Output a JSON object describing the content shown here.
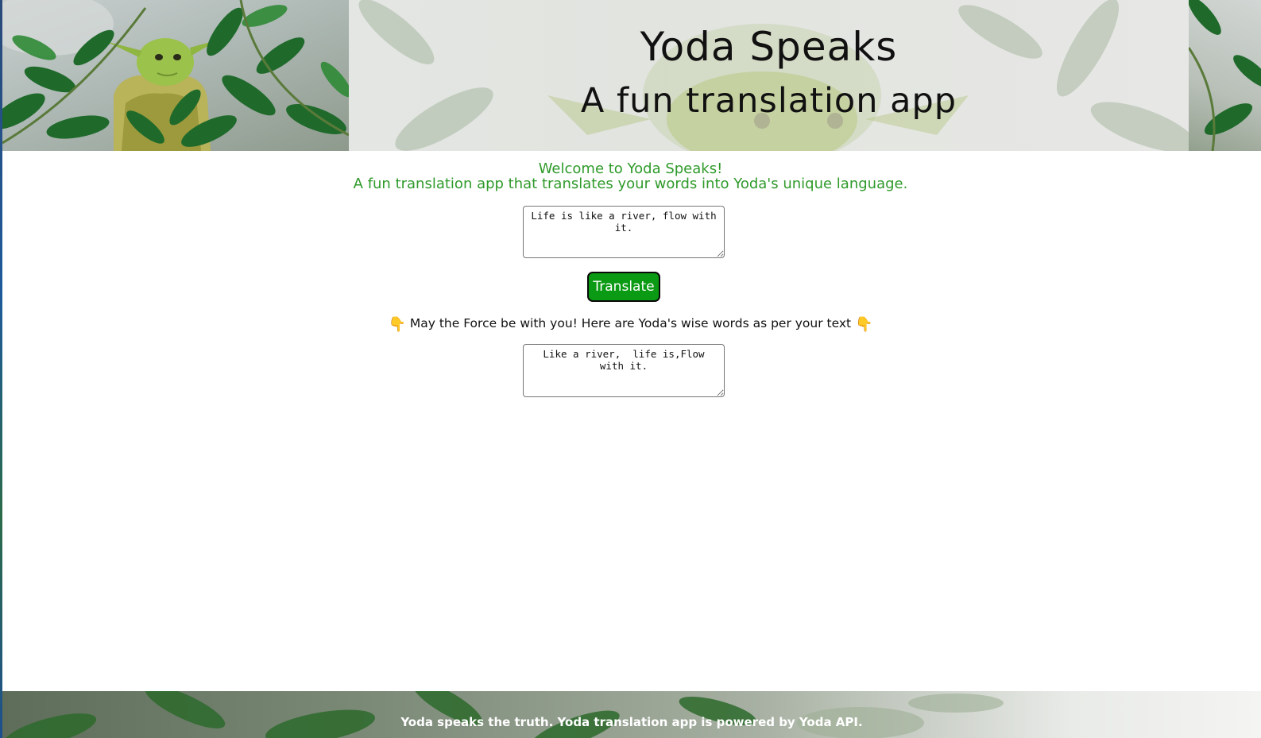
{
  "header": {
    "title": "Yoda Speaks",
    "subtitle": "A fun translation app"
  },
  "intro": {
    "line1": "Welcome to Yoda Speaks!",
    "line2": "A fun translation app that translates your words into Yoda's unique language."
  },
  "input": {
    "value": "Life is like a river, flow with it."
  },
  "translate_button": {
    "label": "Translate"
  },
  "output": {
    "message": "May the Force be with you! Here are Yoda's wise words as per your text",
    "icon": "backhand-index-pointing-down-icon",
    "value": "Like a river,  life is,Flow with it."
  },
  "footer": {
    "text": "Yoda speaks the truth. Yoda translation app is powered by Yoda API."
  },
  "colors": {
    "accent_green": "#2f9a2a",
    "button_green": "#0b9a13"
  }
}
